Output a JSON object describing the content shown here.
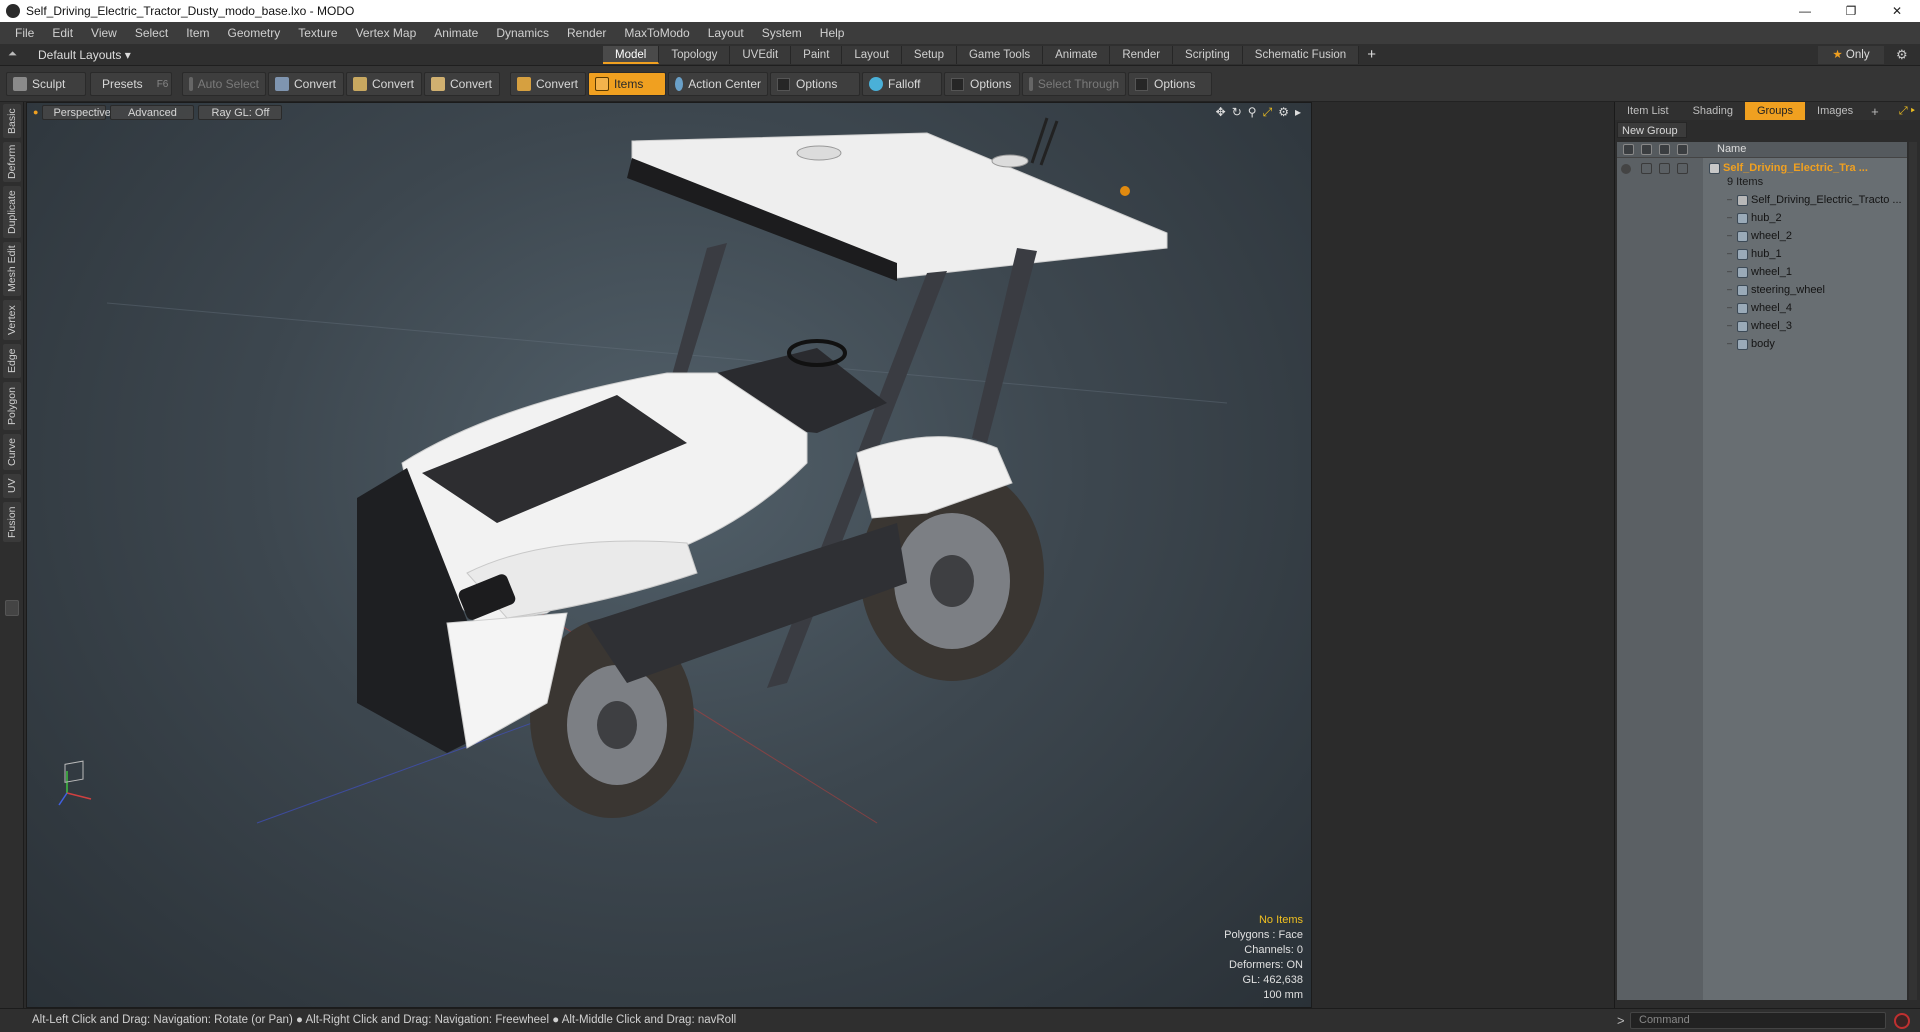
{
  "window": {
    "title": "Self_Driving_Electric_Tractor_Dusty_modo_base.lxo - MODO",
    "minimize": "—",
    "maximize": "❐",
    "close": "✕"
  },
  "menu": [
    "File",
    "Edit",
    "View",
    "Select",
    "Item",
    "Geometry",
    "Texture",
    "Vertex Map",
    "Animate",
    "Dynamics",
    "Render",
    "MaxToModo",
    "Layout",
    "System",
    "Help"
  ],
  "layoutbar": {
    "layouts_label": "Default Layouts ▾",
    "tabs": [
      "Model",
      "Topology",
      "UVEdit",
      "Paint",
      "Layout",
      "Setup",
      "Game Tools",
      "Animate",
      "Render",
      "Scripting",
      "Schematic Fusion"
    ],
    "active_tab": "Model",
    "plus": "+",
    "only_label": "Only",
    "star": "★",
    "gear": "⚙"
  },
  "toolbar": {
    "sculpt": "Sculpt",
    "presets": "Presets",
    "presets_key": "F6",
    "auto_select": "Auto Select",
    "convert1": "Convert",
    "convert2": "Convert",
    "convert3": "Convert",
    "convert4": "Convert",
    "items": "Items",
    "action_center": "Action Center",
    "options1": "Options",
    "falloff": "Falloff",
    "options2": "Options",
    "select_through": "Select Through",
    "options3": "Options"
  },
  "left_tabs": [
    "Basic",
    "Deform",
    "Duplicate",
    "Mesh Edit",
    "Vertex",
    "Edge",
    "Polygon",
    "Curve",
    "UV",
    "Fusion"
  ],
  "viewport": {
    "view_label": "Perspective",
    "shading_label": "Advanced",
    "raygl_label": "Ray GL: Off",
    "info": {
      "no_items": "No Items",
      "polygons": "Polygons : Face",
      "channels": "Channels: 0",
      "deformers": "Deformers: ON",
      "gl": "GL: 462,638",
      "scale": "100 mm"
    }
  },
  "status": {
    "hint": "Alt-Left Click and Drag: Navigation: Rotate (or Pan) ● Alt-Right Click and Drag: Navigation: Freewheel ● Alt-Middle Click and Drag: navRoll",
    "command_placeholder": "Command",
    "prompt": ">"
  },
  "right_panel": {
    "tabs": [
      "Item List",
      "Shading",
      "Groups",
      "Images"
    ],
    "active_tab": "Groups",
    "plus": "+",
    "new_group": "New Group",
    "name_header": "Name",
    "group_name": "Self_Driving_Electric_Tra ...",
    "group_count": "9 Items",
    "items": [
      "Self_Driving_Electric_Tracto ...",
      "hub_2",
      "wheel_2",
      "hub_1",
      "wheel_1",
      "steering_wheel",
      "wheel_4",
      "wheel_3",
      "body"
    ]
  }
}
